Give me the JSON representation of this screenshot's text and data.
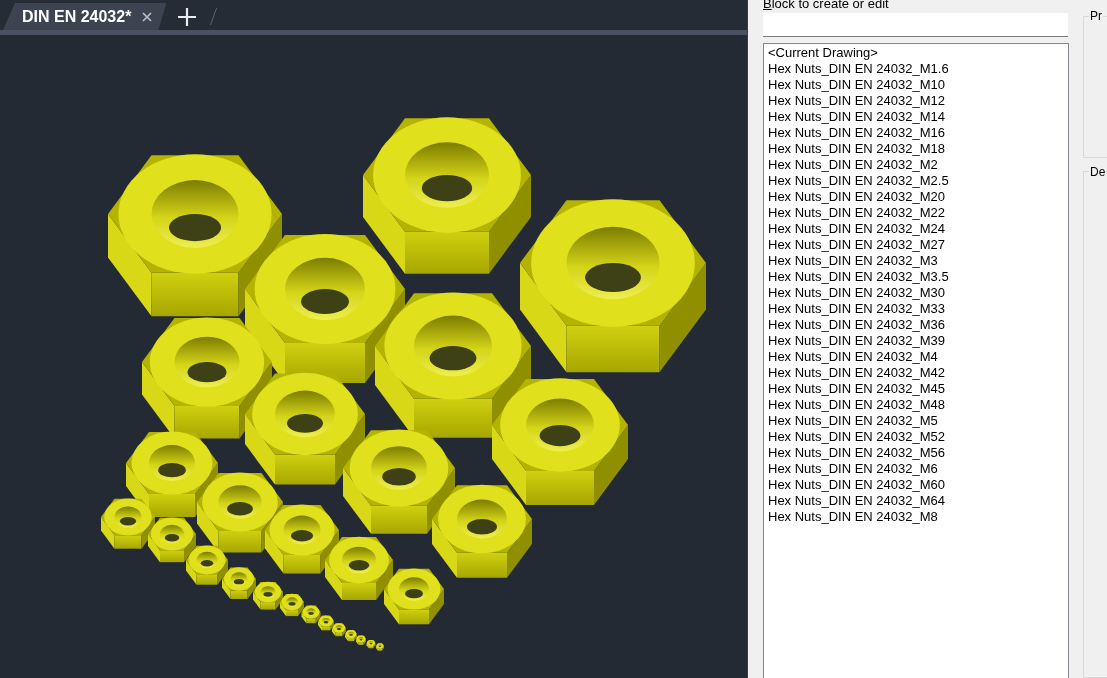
{
  "tabs": [
    {
      "label": "DIN EN 24032*",
      "selected": true
    }
  ],
  "block_field": {
    "label": "Block to create or edit",
    "access_key": true
  },
  "block_list": {
    "items": [
      {
        "label": "<Current Drawing>",
        "selected": false
      },
      {
        "label": "Hex Nuts_DIN EN 24032_M1.6",
        "selected": false
      },
      {
        "label": "Hex Nuts_DIN EN 24032_M10",
        "selected": false
      },
      {
        "label": "Hex Nuts_DIN EN 24032_M12",
        "selected": false
      },
      {
        "label": "Hex Nuts_DIN EN 24032_M14",
        "selected": false
      },
      {
        "label": "Hex Nuts_DIN EN 24032_M16",
        "selected": false
      },
      {
        "label": "Hex Nuts_DIN EN 24032_M18",
        "selected": false
      },
      {
        "label": "Hex Nuts_DIN EN 24032_M2",
        "selected": false
      },
      {
        "label": "Hex Nuts_DIN EN 24032_M2.5",
        "selected": false
      },
      {
        "label": "Hex Nuts_DIN EN 24032_M20",
        "selected": false
      },
      {
        "label": "Hex Nuts_DIN EN 24032_M22",
        "selected": false
      },
      {
        "label": "Hex Nuts_DIN EN 24032_M24",
        "selected": false
      },
      {
        "label": "Hex Nuts_DIN EN 24032_M27",
        "selected": false
      },
      {
        "label": "Hex Nuts_DIN EN 24032_M3",
        "selected": false
      },
      {
        "label": "Hex Nuts_DIN EN 24032_M3.5",
        "selected": false
      },
      {
        "label": "Hex Nuts_DIN EN 24032_M30",
        "selected": false
      },
      {
        "label": "Hex Nuts_DIN EN 24032_M33",
        "selected": false
      },
      {
        "label": "Hex Nuts_DIN EN 24032_M36",
        "selected": false
      },
      {
        "label": "Hex Nuts_DIN EN 24032_M39",
        "selected": false
      },
      {
        "label": "Hex Nuts_DIN EN 24032_M4",
        "selected": false
      },
      {
        "label": "Hex Nuts_DIN EN 24032_M42",
        "selected": false
      },
      {
        "label": "Hex Nuts_DIN EN 24032_M45",
        "selected": false
      },
      {
        "label": "Hex Nuts_DIN EN 24032_M48",
        "selected": false
      },
      {
        "label": "Hex Nuts_DIN EN 24032_M5",
        "selected": false
      },
      {
        "label": "Hex Nuts_DIN EN 24032_M52",
        "selected": false
      },
      {
        "label": "Hex Nuts_DIN EN 24032_M56",
        "selected": false
      },
      {
        "label": "Hex Nuts_DIN EN 24032_M6",
        "selected": false
      },
      {
        "label": "Hex Nuts_DIN EN 24032_M60",
        "selected": false
      },
      {
        "label": "Hex Nuts_DIN EN 24032_M64",
        "selected": false
      },
      {
        "label": "Hex Nuts_DIN EN 24032_M8",
        "selected": false
      }
    ]
  },
  "group_boxes": [
    {
      "title": "Pr"
    },
    {
      "title": "De"
    }
  ]
}
